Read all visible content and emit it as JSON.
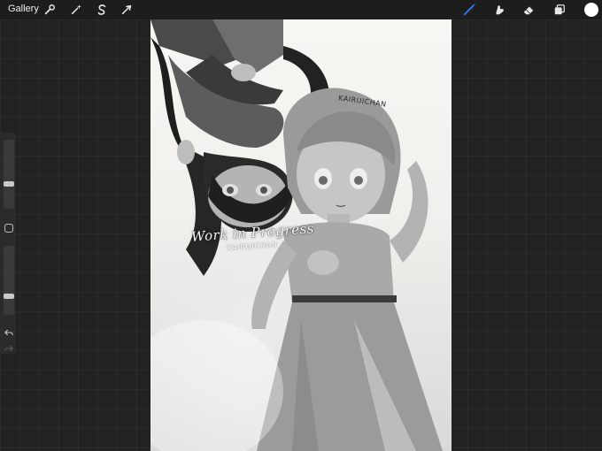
{
  "toolbar": {
    "gallery_label": "Gallery",
    "left_tools": [
      {
        "name": "actions",
        "icon": "wrench-icon"
      },
      {
        "name": "adjustments",
        "icon": "magic-wand-icon"
      },
      {
        "name": "selection",
        "icon": "selection-s-icon"
      },
      {
        "name": "transform",
        "icon": "arrow-cursor-icon"
      }
    ],
    "right_tools": [
      {
        "name": "brush",
        "icon": "brush-icon",
        "active": true
      },
      {
        "name": "smudge",
        "icon": "smudge-finger-icon",
        "active": false
      },
      {
        "name": "eraser",
        "icon": "eraser-icon",
        "active": false
      },
      {
        "name": "layers",
        "icon": "layers-icon",
        "active": false
      }
    ],
    "current_color": "#ffffff",
    "accent_color": "#2f7bf6"
  },
  "sidebar": {
    "brush_size_level": 0.35,
    "opacity_level": 0.25,
    "modify_icon": "square-icon",
    "undo_icon": "undo-arrow-icon",
    "redo_icon": "redo-arrow-icon"
  },
  "canvas": {
    "signature_top": "KAIRUICHAN",
    "watermark_title": "Work in Progress",
    "watermark_signature": "KAIRUICHAN"
  }
}
